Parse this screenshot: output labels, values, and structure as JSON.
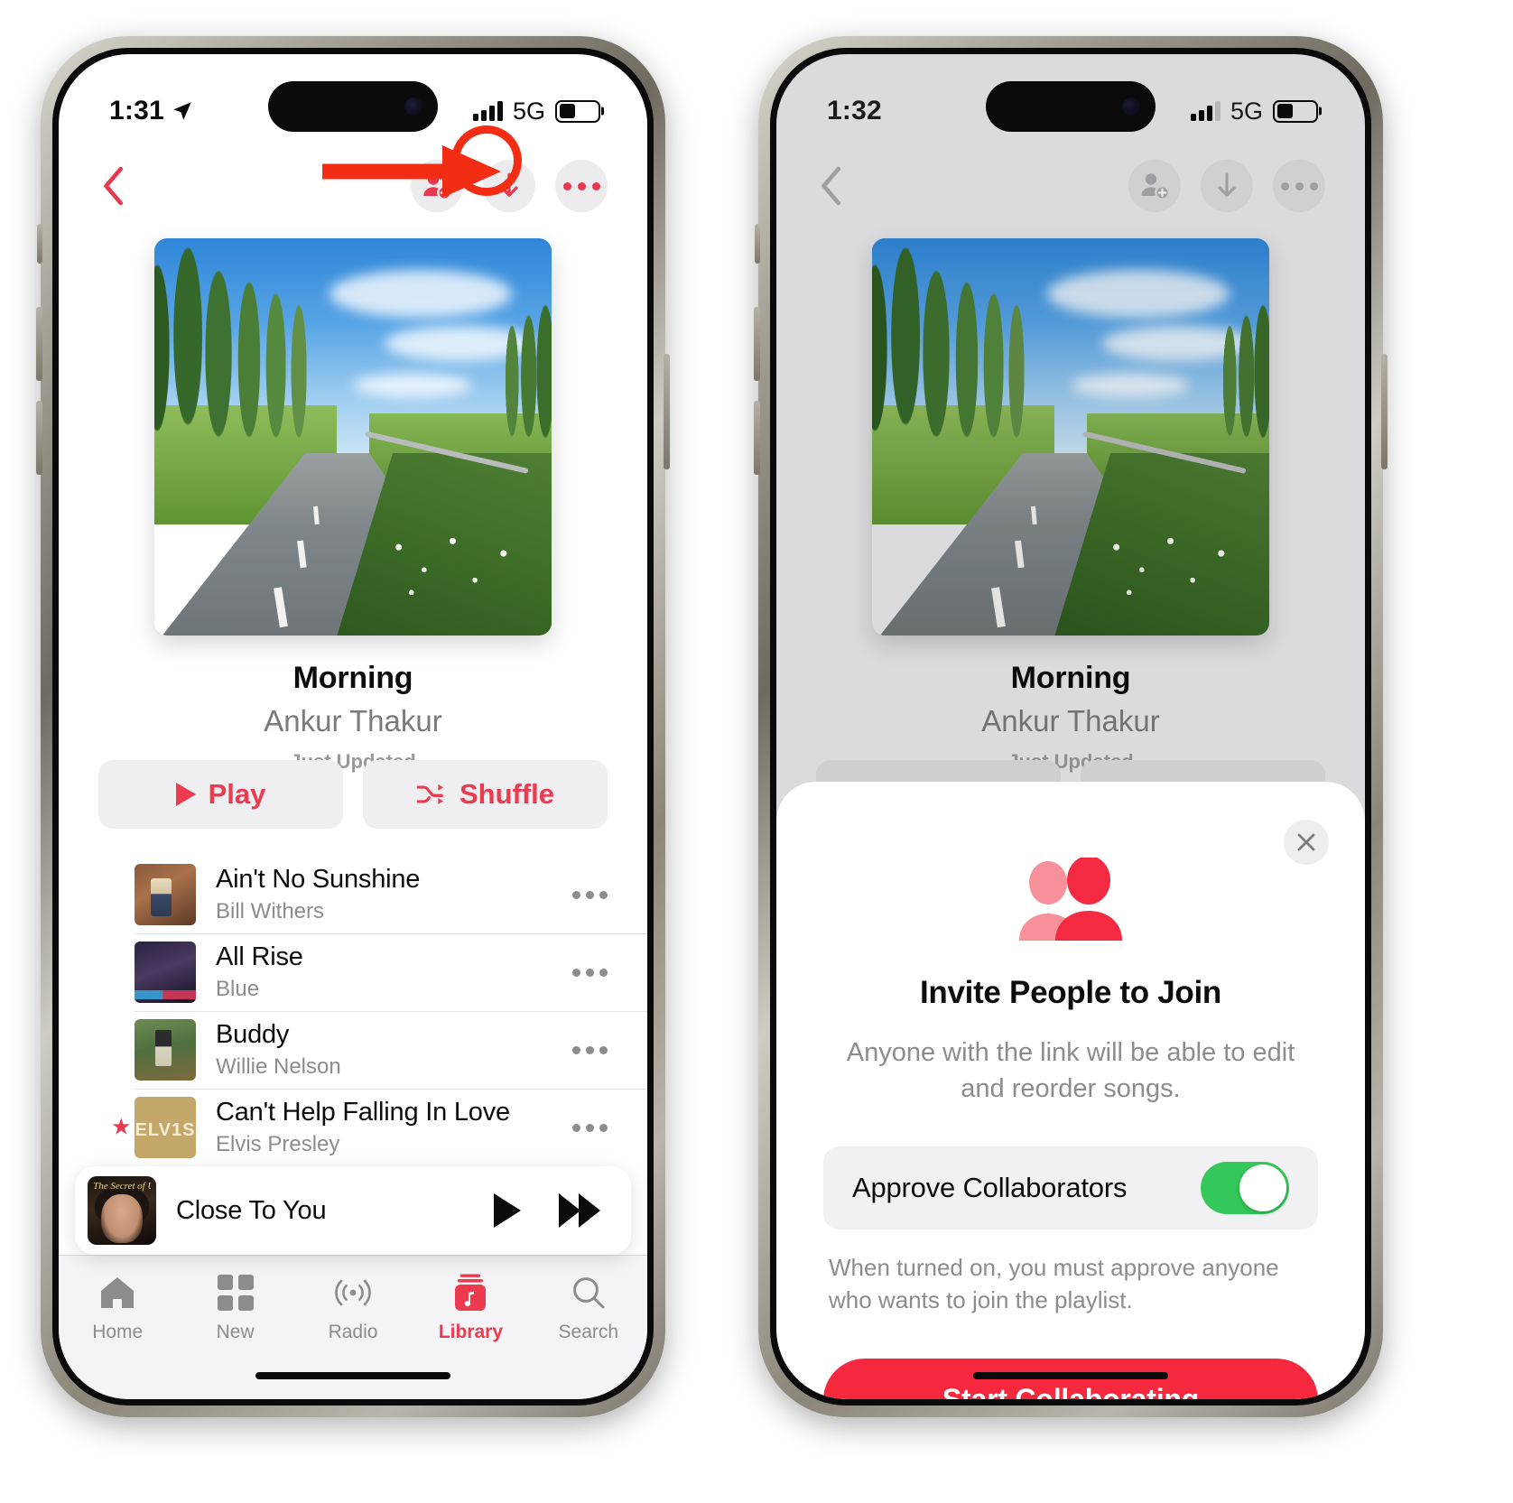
{
  "screens": [
    {
      "id": "playlist",
      "status_bar": {
        "time": "1:31",
        "location_icon": "location-arrow-icon",
        "network": "5G",
        "signal_label": "cellular-signal",
        "battery_label": "battery"
      },
      "nav": {
        "back_label": "Back",
        "add_collaborator_label": "Add Collaborator",
        "download_label": "Download",
        "more_label": "More"
      },
      "playlist": {
        "artwork_alt": "Tree-lined road with canal at sunrise",
        "title": "Morning",
        "artist": "Ankur Thakur",
        "updated": "Just Updated"
      },
      "actions": {
        "play": "Play",
        "shuffle": "Shuffle"
      },
      "songs": [
        {
          "title": "Ain't No Sunshine",
          "artist": "Bill Withers",
          "starred": false
        },
        {
          "title": "All Rise",
          "artist": "Blue",
          "starred": false
        },
        {
          "title": "Buddy",
          "artist": "Willie Nelson",
          "starred": false
        },
        {
          "title": "Can't Help Falling In Love",
          "artist": "Elvis Presley",
          "starred": true,
          "art_text": "ELV1S"
        }
      ],
      "now_playing": {
        "title": "Close To You",
        "art_caption": "The Secret of Us",
        "play_label": "Play",
        "next_label": "Next"
      },
      "tabs": [
        {
          "label": "Home",
          "icon": "home-icon",
          "active": false
        },
        {
          "label": "New",
          "icon": "grid-icon",
          "active": false
        },
        {
          "label": "Radio",
          "icon": "radio-waves-icon",
          "active": false
        },
        {
          "label": "Library",
          "icon": "library-icon",
          "active": true
        },
        {
          "label": "Search",
          "icon": "search-icon",
          "active": false
        }
      ],
      "annotation": {
        "arrow": "red-arrow-pointing-right",
        "ring": "red-circle-highlight",
        "target": "add-collaborator-button"
      }
    },
    {
      "id": "invite-sheet",
      "status_bar": {
        "time": "1:32",
        "network": "5G",
        "signal_label": "cellular-signal",
        "battery_label": "battery"
      },
      "nav": {
        "back_label": "Back",
        "add_collaborator_label": "Add Collaborator",
        "download_label": "Download",
        "more_label": "More"
      },
      "playlist": {
        "artwork_alt": "Tree-lined road with canal at sunrise",
        "title": "Morning",
        "artist": "Ankur Thakur",
        "updated": "Just Updated"
      },
      "sheet": {
        "close_label": "Close",
        "icon": "two-people-icon",
        "heading": "Invite People to Join",
        "body": "Anyone with the link will be able to edit and reorder songs.",
        "toggle": {
          "label": "Approve Collaborators",
          "on": true,
          "state_text": "On"
        },
        "note": "When turned on, you must approve anyone who wants to join the playlist.",
        "cta": "Start Collaborating"
      }
    }
  ],
  "colors": {
    "accent_red": "#ec3a4f",
    "cta_red": "#f5283e",
    "annotation_red": "#f22d14",
    "toggle_green": "#34c759",
    "secondary_text": "#8c8c90"
  }
}
